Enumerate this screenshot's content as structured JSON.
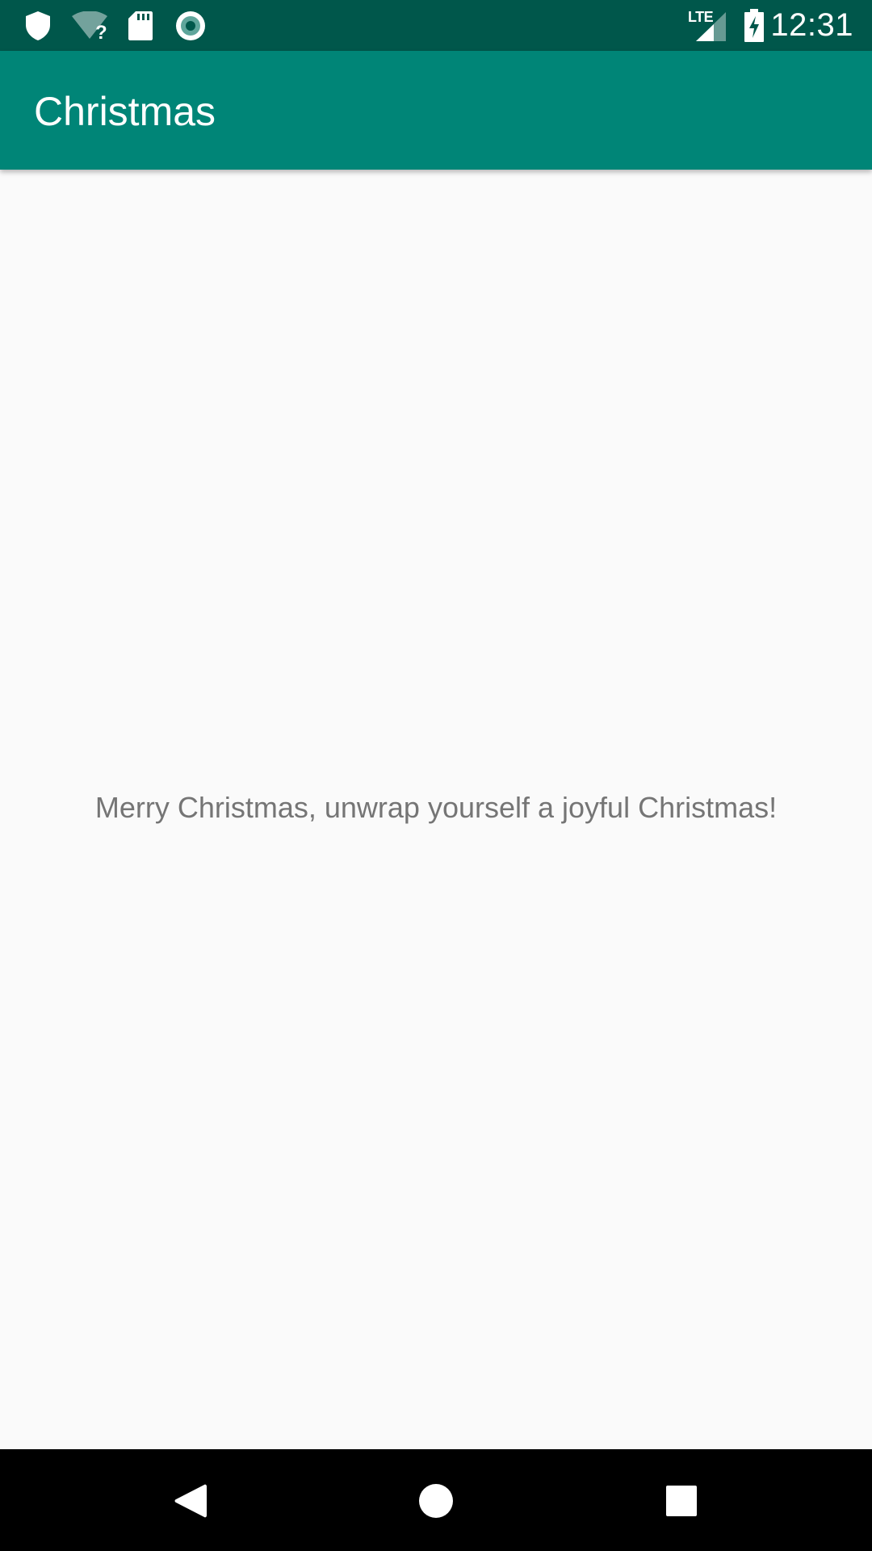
{
  "status_bar": {
    "time": "12:31",
    "network_label": "LTE",
    "icons": [
      "shield-icon",
      "wifi-unknown-icon",
      "sd-card-icon",
      "record-icon",
      "signal-icon",
      "battery-charging-icon"
    ]
  },
  "app_bar": {
    "title": "Christmas"
  },
  "content": {
    "message": "Merry Christmas, unwrap yourself a joyful Christmas!"
  },
  "nav_bar": {
    "buttons": [
      "back-icon",
      "home-icon",
      "recents-icon"
    ]
  },
  "colors": {
    "status_bar": "#00574b",
    "app_bar": "#008577",
    "background": "#fafafa",
    "message_text": "#757575"
  }
}
